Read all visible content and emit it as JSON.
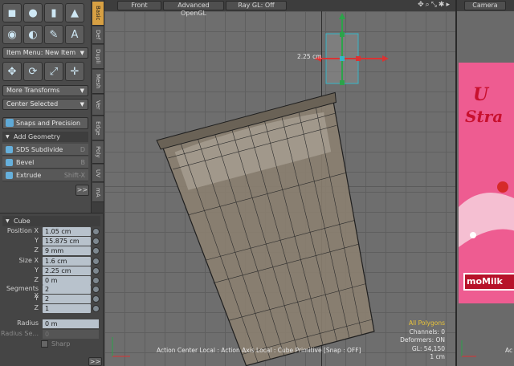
{
  "toolbar": {
    "tabs": [
      "Basic",
      "Def",
      "Dupli",
      "Mesh",
      "Ver",
      "Edge",
      "Poly",
      "UV",
      "mA"
    ],
    "item_menu": "Item Menu: New Item",
    "more_transforms": "More Transforms",
    "center_selected": "Center Selected",
    "snaps": "Snaps and Precision",
    "add_geometry": "Add Geometry",
    "geometry_items": [
      {
        "label": "SDS Subdivide",
        "shortcut": "D"
      },
      {
        "label": "Bevel",
        "shortcut": "B"
      },
      {
        "label": "Extrude",
        "shortcut": "Shift-X"
      }
    ],
    "more_label": ">>"
  },
  "properties": {
    "title": "Cube",
    "position": {
      "label": "Position",
      "x": "1.05 cm",
      "y": "15.875 cm",
      "z": "9 mm"
    },
    "size": {
      "label": "Size",
      "x": "1.6 cm",
      "y": "2.25 cm",
      "z": "0 m"
    },
    "segments": {
      "label": "Segments",
      "x": "2",
      "y": "2",
      "z": "1"
    },
    "axis_labels": {
      "x": "X",
      "y": "Y",
      "z": "Z"
    },
    "radius": {
      "label": "Radius",
      "value": "0 m"
    },
    "radius_segments": {
      "label": "Radius Se...",
      "value": "0"
    },
    "sharp": "Sharp",
    "more_label": ">>"
  },
  "viewport": {
    "tabs": [
      "Front",
      "Advanced OpenGL",
      "Ray GL: Off"
    ],
    "dim_label": "2.25 cm",
    "status": "Action Center Local : Action Axis Local : Cube Primitive  [Snap : OFF]",
    "stats": {
      "selection": "All Polygons",
      "channels": "Channels: 0",
      "deformers": "Deformers: ON",
      "gl": "GL: 54,150",
      "scale": "1 cm"
    }
  },
  "camera": {
    "tab": "Camera",
    "poster_text_1": "U",
    "poster_text_2": "Stra",
    "logo": "moMilk",
    "status": "Ac"
  },
  "colors": {
    "active_tab": "#d7a043",
    "poster": "#ee5c91",
    "mesh_fill": "#8a7f70",
    "stats_highlight": "#e9c33a"
  }
}
